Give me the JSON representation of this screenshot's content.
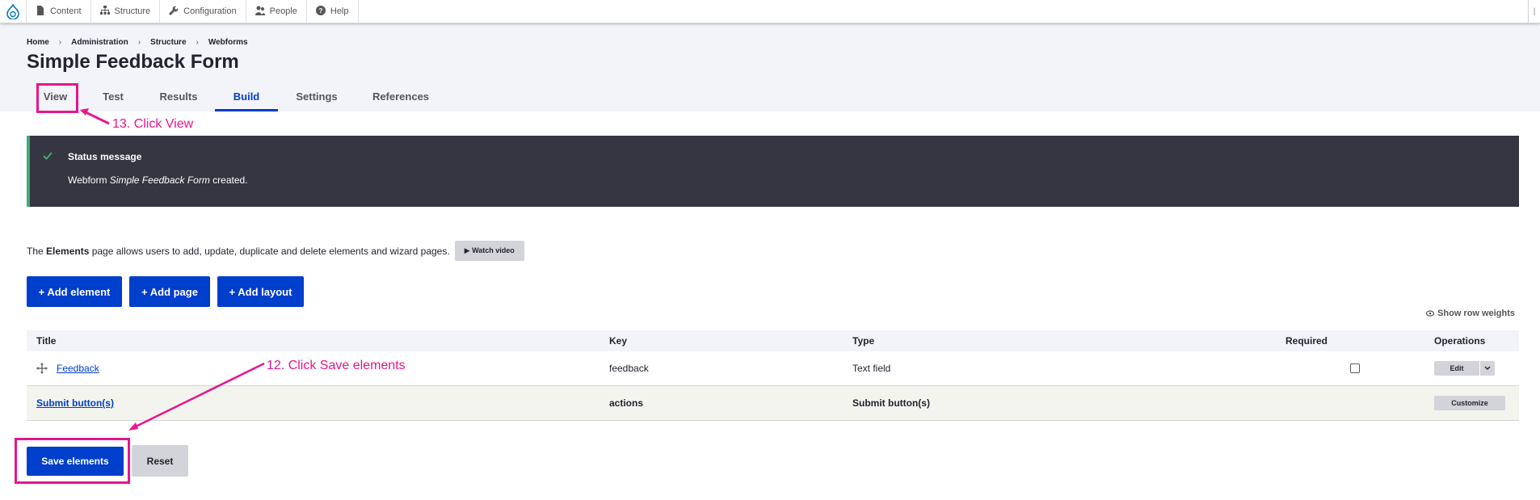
{
  "toolbar": {
    "items": [
      {
        "label": "Content",
        "icon": "file-icon"
      },
      {
        "label": "Structure",
        "icon": "sitemap-icon"
      },
      {
        "label": "Configuration",
        "icon": "wrench-icon"
      },
      {
        "label": "People",
        "icon": "people-icon"
      },
      {
        "label": "Help",
        "icon": "help-icon"
      }
    ]
  },
  "breadcrumb": [
    "Home",
    "Administration",
    "Structure",
    "Webforms"
  ],
  "page_title": "Simple Feedback Form",
  "tabs": [
    {
      "label": "View"
    },
    {
      "label": "Test"
    },
    {
      "label": "Results"
    },
    {
      "label": "Build",
      "active": true
    },
    {
      "label": "Settings"
    },
    {
      "label": "References"
    }
  ],
  "status": {
    "title": "Status message",
    "prefix": "Webform ",
    "emphasis": "Simple Feedback Form",
    "suffix": " created."
  },
  "intro": {
    "prefix": "The ",
    "bold": "Elements",
    "rest": " page allows users to add, update, duplicate and delete elements and wizard pages.",
    "watch_video": "▶ Watch video"
  },
  "actions": {
    "add_element": "+ Add element",
    "add_page": "+ Add page",
    "add_layout": "+ Add layout"
  },
  "show_row_weights": "Show row weights",
  "table": {
    "headers": {
      "title": "Title",
      "key": "Key",
      "type": "Type",
      "required": "Required",
      "operations": "Operations"
    },
    "rows": [
      {
        "title": "Feedback",
        "key": "feedback",
        "type": "Text field",
        "required": false,
        "operation": "Edit"
      },
      {
        "title": "Submit button(s)",
        "key": "actions",
        "type": "Submit button(s)",
        "operation": "Customize"
      }
    ]
  },
  "buttons": {
    "save": "Save elements",
    "reset": "Reset"
  },
  "annotations": {
    "click_view": "13. Click View",
    "click_save": "12. Click Save elements"
  },
  "colors": {
    "accent": "#003ecc",
    "annotation": "#e8158e",
    "status_bg": "#353641",
    "status_border": "#42a877"
  }
}
